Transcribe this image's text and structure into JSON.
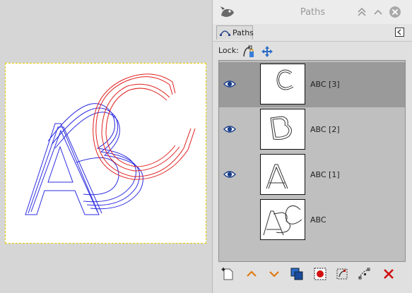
{
  "dock": {
    "title": "Paths",
    "tab_label": "Paths",
    "lock_label": "Lock:",
    "items": [
      {
        "label": "ABC [3]",
        "visible": true,
        "selected": true
      },
      {
        "label": "ABC [2]",
        "visible": true,
        "selected": false
      },
      {
        "label": "ABC [1]",
        "visible": true,
        "selected": false
      },
      {
        "label": "ABC",
        "visible": false,
        "selected": false
      }
    ]
  },
  "canvas": {
    "letters": [
      {
        "text": "A",
        "color": "#2e2ee0"
      },
      {
        "text": "B",
        "color": "#2e2ee0"
      },
      {
        "text": "C",
        "color": "#e02020"
      }
    ]
  },
  "colors": {
    "selected_row": "#9a9a9a",
    "list_bg": "#bfbfbf",
    "path_blue": "#2e2ee0",
    "path_red": "#e02020"
  }
}
